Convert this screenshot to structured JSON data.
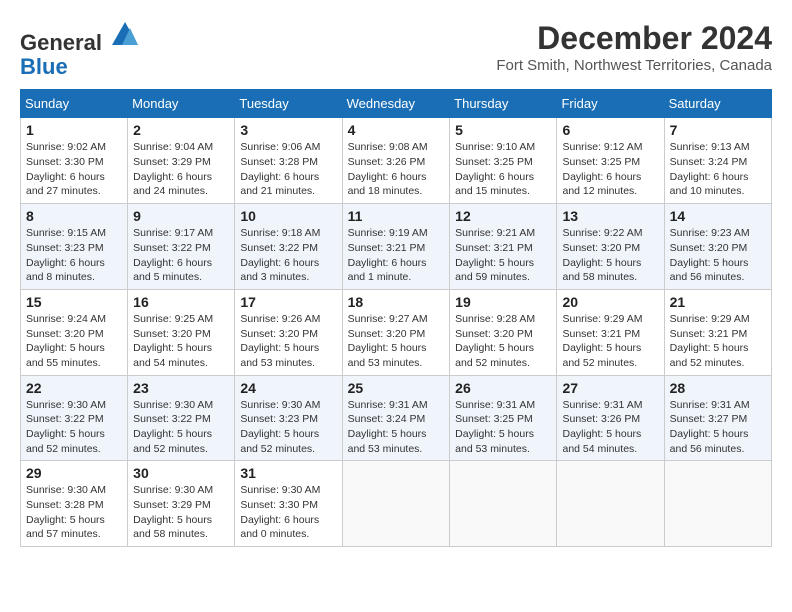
{
  "header": {
    "logo_line1": "General",
    "logo_line2": "Blue",
    "month_title": "December 2024",
    "location": "Fort Smith, Northwest Territories, Canada"
  },
  "weekdays": [
    "Sunday",
    "Monday",
    "Tuesday",
    "Wednesday",
    "Thursday",
    "Friday",
    "Saturday"
  ],
  "weeks": [
    [
      {
        "day": "1",
        "info": "Sunrise: 9:02 AM\nSunset: 3:30 PM\nDaylight: 6 hours and 27 minutes."
      },
      {
        "day": "2",
        "info": "Sunrise: 9:04 AM\nSunset: 3:29 PM\nDaylight: 6 hours and 24 minutes."
      },
      {
        "day": "3",
        "info": "Sunrise: 9:06 AM\nSunset: 3:28 PM\nDaylight: 6 hours and 21 minutes."
      },
      {
        "day": "4",
        "info": "Sunrise: 9:08 AM\nSunset: 3:26 PM\nDaylight: 6 hours and 18 minutes."
      },
      {
        "day": "5",
        "info": "Sunrise: 9:10 AM\nSunset: 3:25 PM\nDaylight: 6 hours and 15 minutes."
      },
      {
        "day": "6",
        "info": "Sunrise: 9:12 AM\nSunset: 3:25 PM\nDaylight: 6 hours and 12 minutes."
      },
      {
        "day": "7",
        "info": "Sunrise: 9:13 AM\nSunset: 3:24 PM\nDaylight: 6 hours and 10 minutes."
      }
    ],
    [
      {
        "day": "8",
        "info": "Sunrise: 9:15 AM\nSunset: 3:23 PM\nDaylight: 6 hours and 8 minutes."
      },
      {
        "day": "9",
        "info": "Sunrise: 9:17 AM\nSunset: 3:22 PM\nDaylight: 6 hours and 5 minutes."
      },
      {
        "day": "10",
        "info": "Sunrise: 9:18 AM\nSunset: 3:22 PM\nDaylight: 6 hours and 3 minutes."
      },
      {
        "day": "11",
        "info": "Sunrise: 9:19 AM\nSunset: 3:21 PM\nDaylight: 6 hours and 1 minute."
      },
      {
        "day": "12",
        "info": "Sunrise: 9:21 AM\nSunset: 3:21 PM\nDaylight: 5 hours and 59 minutes."
      },
      {
        "day": "13",
        "info": "Sunrise: 9:22 AM\nSunset: 3:20 PM\nDaylight: 5 hours and 58 minutes."
      },
      {
        "day": "14",
        "info": "Sunrise: 9:23 AM\nSunset: 3:20 PM\nDaylight: 5 hours and 56 minutes."
      }
    ],
    [
      {
        "day": "15",
        "info": "Sunrise: 9:24 AM\nSunset: 3:20 PM\nDaylight: 5 hours and 55 minutes."
      },
      {
        "day": "16",
        "info": "Sunrise: 9:25 AM\nSunset: 3:20 PM\nDaylight: 5 hours and 54 minutes."
      },
      {
        "day": "17",
        "info": "Sunrise: 9:26 AM\nSunset: 3:20 PM\nDaylight: 5 hours and 53 minutes."
      },
      {
        "day": "18",
        "info": "Sunrise: 9:27 AM\nSunset: 3:20 PM\nDaylight: 5 hours and 53 minutes."
      },
      {
        "day": "19",
        "info": "Sunrise: 9:28 AM\nSunset: 3:20 PM\nDaylight: 5 hours and 52 minutes."
      },
      {
        "day": "20",
        "info": "Sunrise: 9:29 AM\nSunset: 3:21 PM\nDaylight: 5 hours and 52 minutes."
      },
      {
        "day": "21",
        "info": "Sunrise: 9:29 AM\nSunset: 3:21 PM\nDaylight: 5 hours and 52 minutes."
      }
    ],
    [
      {
        "day": "22",
        "info": "Sunrise: 9:30 AM\nSunset: 3:22 PM\nDaylight: 5 hours and 52 minutes."
      },
      {
        "day": "23",
        "info": "Sunrise: 9:30 AM\nSunset: 3:22 PM\nDaylight: 5 hours and 52 minutes."
      },
      {
        "day": "24",
        "info": "Sunrise: 9:30 AM\nSunset: 3:23 PM\nDaylight: 5 hours and 52 minutes."
      },
      {
        "day": "25",
        "info": "Sunrise: 9:31 AM\nSunset: 3:24 PM\nDaylight: 5 hours and 53 minutes."
      },
      {
        "day": "26",
        "info": "Sunrise: 9:31 AM\nSunset: 3:25 PM\nDaylight: 5 hours and 53 minutes."
      },
      {
        "day": "27",
        "info": "Sunrise: 9:31 AM\nSunset: 3:26 PM\nDaylight: 5 hours and 54 minutes."
      },
      {
        "day": "28",
        "info": "Sunrise: 9:31 AM\nSunset: 3:27 PM\nDaylight: 5 hours and 56 minutes."
      }
    ],
    [
      {
        "day": "29",
        "info": "Sunrise: 9:30 AM\nSunset: 3:28 PM\nDaylight: 5 hours and 57 minutes."
      },
      {
        "day": "30",
        "info": "Sunrise: 9:30 AM\nSunset: 3:29 PM\nDaylight: 5 hours and 58 minutes."
      },
      {
        "day": "31",
        "info": "Sunrise: 9:30 AM\nSunset: 3:30 PM\nDaylight: 6 hours and 0 minutes."
      },
      {
        "day": "",
        "info": ""
      },
      {
        "day": "",
        "info": ""
      },
      {
        "day": "",
        "info": ""
      },
      {
        "day": "",
        "info": ""
      }
    ]
  ]
}
